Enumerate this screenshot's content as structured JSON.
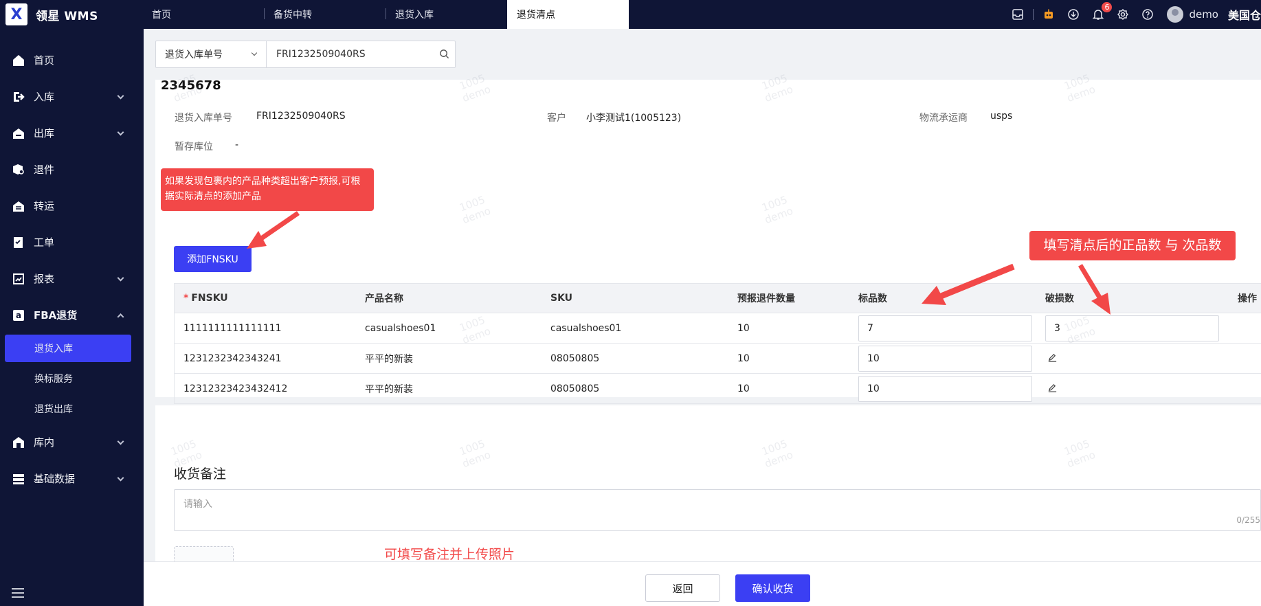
{
  "app": {
    "logo_letter": "X",
    "title": "领星 WMS"
  },
  "tabs": [
    {
      "label": "首页"
    },
    {
      "label": "备货中转"
    },
    {
      "label": "退货入库"
    },
    {
      "label": "退货清点"
    }
  ],
  "topbar": {
    "notification_count": "6",
    "username": "demo",
    "warehouse": "美国仓"
  },
  "sidebar": {
    "items": [
      {
        "label": "首页"
      },
      {
        "label": "入库"
      },
      {
        "label": "出库"
      },
      {
        "label": "退件"
      },
      {
        "label": "转运"
      },
      {
        "label": "工单"
      },
      {
        "label": "报表"
      },
      {
        "label": "FBA退货"
      },
      {
        "label": "库内"
      },
      {
        "label": "基础数据"
      }
    ],
    "fba_sub": [
      {
        "label": "退货入库"
      },
      {
        "label": "换标服务"
      },
      {
        "label": "退货出库"
      }
    ]
  },
  "search": {
    "type_label": "退货入库单号",
    "value": "FRI1232509040RS"
  },
  "order": {
    "title": "2345678",
    "no_label": "退货入库单号",
    "no_value": "FRI1232509040RS",
    "customer_label": "客户",
    "customer_value": "小李测试1(1005123)",
    "carrier_label": "物流承运商",
    "carrier_value": "usps",
    "temp_loc_label": "暂存库位",
    "temp_loc_value": "-"
  },
  "callouts": {
    "add_hint": "如果发现包裹内的产品种类超出客户预报,可根据实际清点的添加产品",
    "qty_hint": "填写清点后的正品数 与 次品数",
    "remark_hint": "可填写备注并上传照片"
  },
  "add_button": "添加FNSKU",
  "table": {
    "headers": {
      "required": "*",
      "fnsku": "FNSKU",
      "name": "产品名称",
      "sku": "SKU",
      "qty": "预报退件数量",
      "good": "标品数",
      "damaged": "破损数",
      "op": "操作"
    },
    "rows": [
      {
        "fnsku": "1111111111111111",
        "name": "casualshoes01",
        "sku": "casualshoes01",
        "qty": "10",
        "good": "7",
        "damaged": "3"
      },
      {
        "fnsku": "1231232342343241",
        "name": "平平的新装",
        "sku": "08050805",
        "qty": "10",
        "good": "10",
        "damaged": ""
      },
      {
        "fnsku": "12312323423432412",
        "name": "平平的新装",
        "sku": "08050805",
        "qty": "10",
        "good": "10",
        "damaged": ""
      }
    ]
  },
  "remark": {
    "title": "收货备注",
    "placeholder": "请输入",
    "count": "0/255"
  },
  "footer": {
    "back": "返回",
    "confirm": "确认收货"
  },
  "watermark": {
    "line1": "1005",
    "line2": "demo"
  },
  "colors": {
    "nav_bg": "#0f1536",
    "primary": "#3b3ff3",
    "callout": "#f24848"
  }
}
